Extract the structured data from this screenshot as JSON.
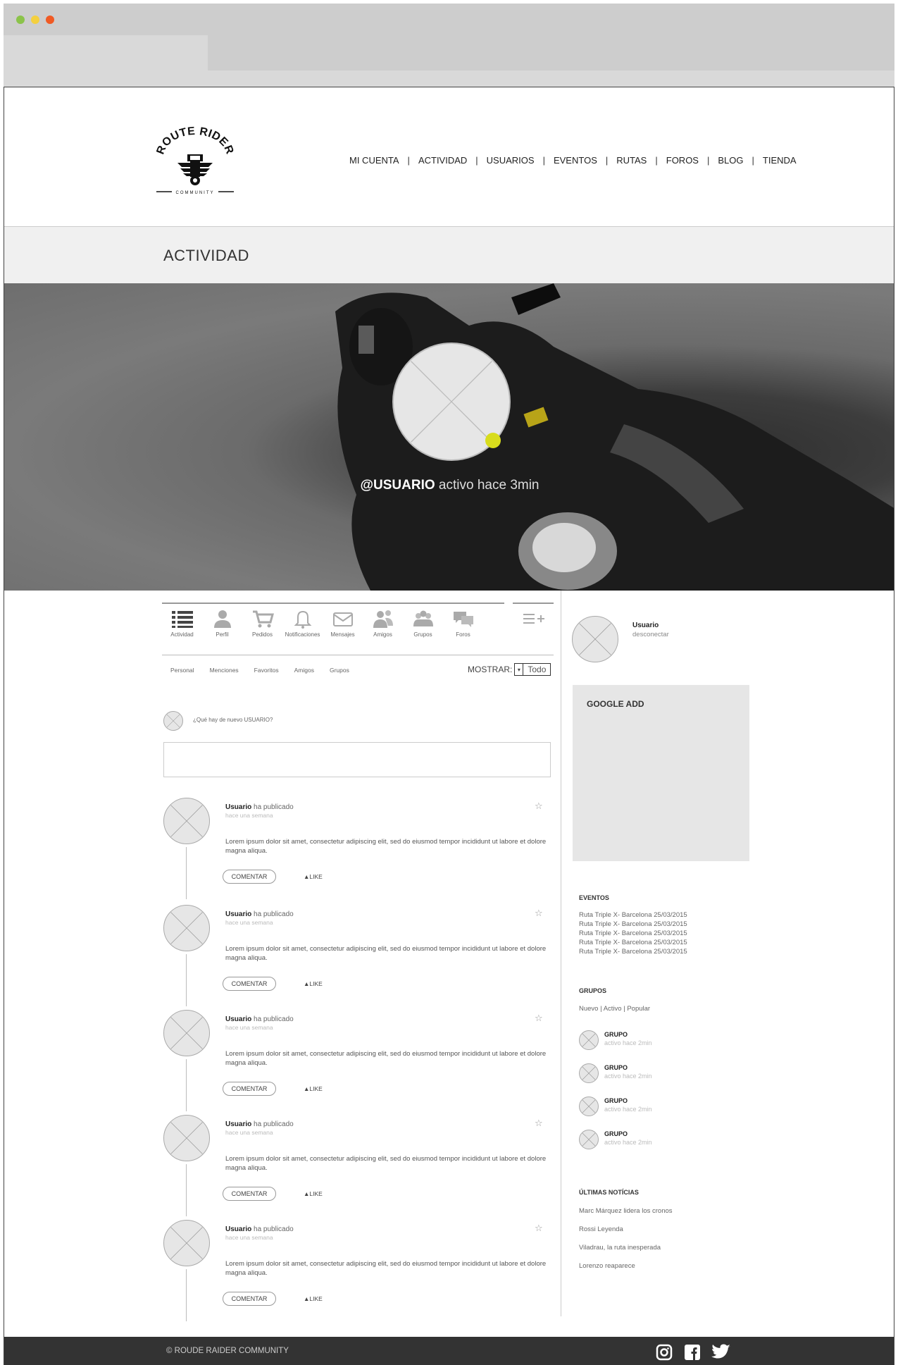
{
  "nav": {
    "items": [
      "MI CUENTA",
      "ACTIVIDAD",
      "USUARIOS",
      "EVENTOS",
      "RUTAS",
      "FOROS",
      "BLOG",
      "TIENDA"
    ],
    "separator": "|"
  },
  "logo": {
    "top_text": "ROUTE RIDER",
    "bottom_text": "COMMUNITY"
  },
  "page_title": "ACTIVIDAD",
  "hero": {
    "username": "@USUARIO",
    "status": "activo hace 3min",
    "status_color": "#d8dc1c"
  },
  "profile_tabs": [
    {
      "label": "Actividad",
      "icon": "list-icon"
    },
    {
      "label": "Perfil",
      "icon": "user-icon"
    },
    {
      "label": "Pedidos",
      "icon": "cart-icon"
    },
    {
      "label": "Notificaciones",
      "icon": "bell-icon"
    },
    {
      "label": "Mensajes",
      "icon": "mail-icon"
    },
    {
      "label": "Amigos",
      "icon": "friends-icon"
    },
    {
      "label": "Grupos",
      "icon": "group-icon"
    },
    {
      "label": "Foros",
      "icon": "chat-icon"
    }
  ],
  "subtabs": [
    "Personal",
    "Menciones",
    "Favoritos",
    "Amigos",
    "Grupos"
  ],
  "filter": {
    "label": "MOSTRAR:",
    "value": "Todo"
  },
  "new_post": {
    "prompt": "¿Qué hay de nuevo USUARIO?"
  },
  "posts": [
    {
      "user": "Usuario",
      "action": "ha publicado",
      "time": "hace una semana",
      "body": "Lorem ipsum dolor sit amet, consectetur adipiscing elit, sed do eiusmod tempor incididunt ut labore et dolore magna aliqua.",
      "comment_label": "COMENTAR",
      "like_label": "▲LIKE"
    },
    {
      "user": "Usuario",
      "action": "ha publicado",
      "time": "hace una semana",
      "body": "Lorem ipsum dolor sit amet, consectetur adipiscing elit, sed do eiusmod tempor incididunt ut labore et dolore magna aliqua.",
      "comment_label": "COMENTAR",
      "like_label": "▲LIKE"
    },
    {
      "user": "Usuario",
      "action": "ha publicado",
      "time": "hace una semana",
      "body": "Lorem ipsum dolor sit amet, consectetur adipiscing elit, sed do eiusmod tempor incididunt ut labore et dolore magna aliqua.",
      "comment_label": "COMENTAR",
      "like_label": "▲LIKE"
    },
    {
      "user": "Usuario",
      "action": "ha publicado",
      "time": "hace una semana",
      "body": "Lorem ipsum dolor sit amet, consectetur adipiscing elit, sed do eiusmod tempor incididunt ut labore et dolore magna aliqua.",
      "comment_label": "COMENTAR",
      "like_label": "▲LIKE"
    },
    {
      "user": "Usuario",
      "action": "ha publicado",
      "time": "hace una semana",
      "body": "Lorem ipsum dolor sit amet, consectetur adipiscing elit, sed do eiusmod tempor incididunt ut labore et dolore magna aliqua.",
      "comment_label": "COMENTAR",
      "like_label": "▲LIKE"
    }
  ],
  "sidebar": {
    "user": "Usuario",
    "logout": "desconectar",
    "ad_label": "GOOGLE ADD",
    "events_title": "EVENTOS",
    "events": [
      "Ruta Triple X- Barcelona 25/03/2015",
      "Ruta Triple X- Barcelona 25/03/2015",
      "Ruta Triple X- Barcelona 25/03/2015",
      "Ruta Triple X- Barcelona 25/03/2015",
      "Ruta Triple X- Barcelona 25/03/2015"
    ],
    "groups_title": "GRUPOS",
    "group_filters": [
      "Nuevo",
      "Activo",
      "Popular"
    ],
    "groups": [
      {
        "name": "GRUPO",
        "status": "activo hace 2min"
      },
      {
        "name": "GRUPO",
        "status": "activo hace 2min"
      },
      {
        "name": "GRUPO",
        "status": "activo hace 2min"
      },
      {
        "name": "GRUPO",
        "status": "activo hace 2min"
      }
    ],
    "news_title": "ÚLTIMAS NOTÍCIAS",
    "news": [
      "Marc Márquez lidera los cronos",
      "Rossi Leyenda",
      "Viladrau, la ruta inesperada",
      "Lorenzo reaparece"
    ]
  },
  "footer": {
    "copyright": "© ROUDE RAIDER COMMUNITY",
    "social": [
      "instagram-icon",
      "facebook-icon",
      "twitter-icon"
    ]
  }
}
